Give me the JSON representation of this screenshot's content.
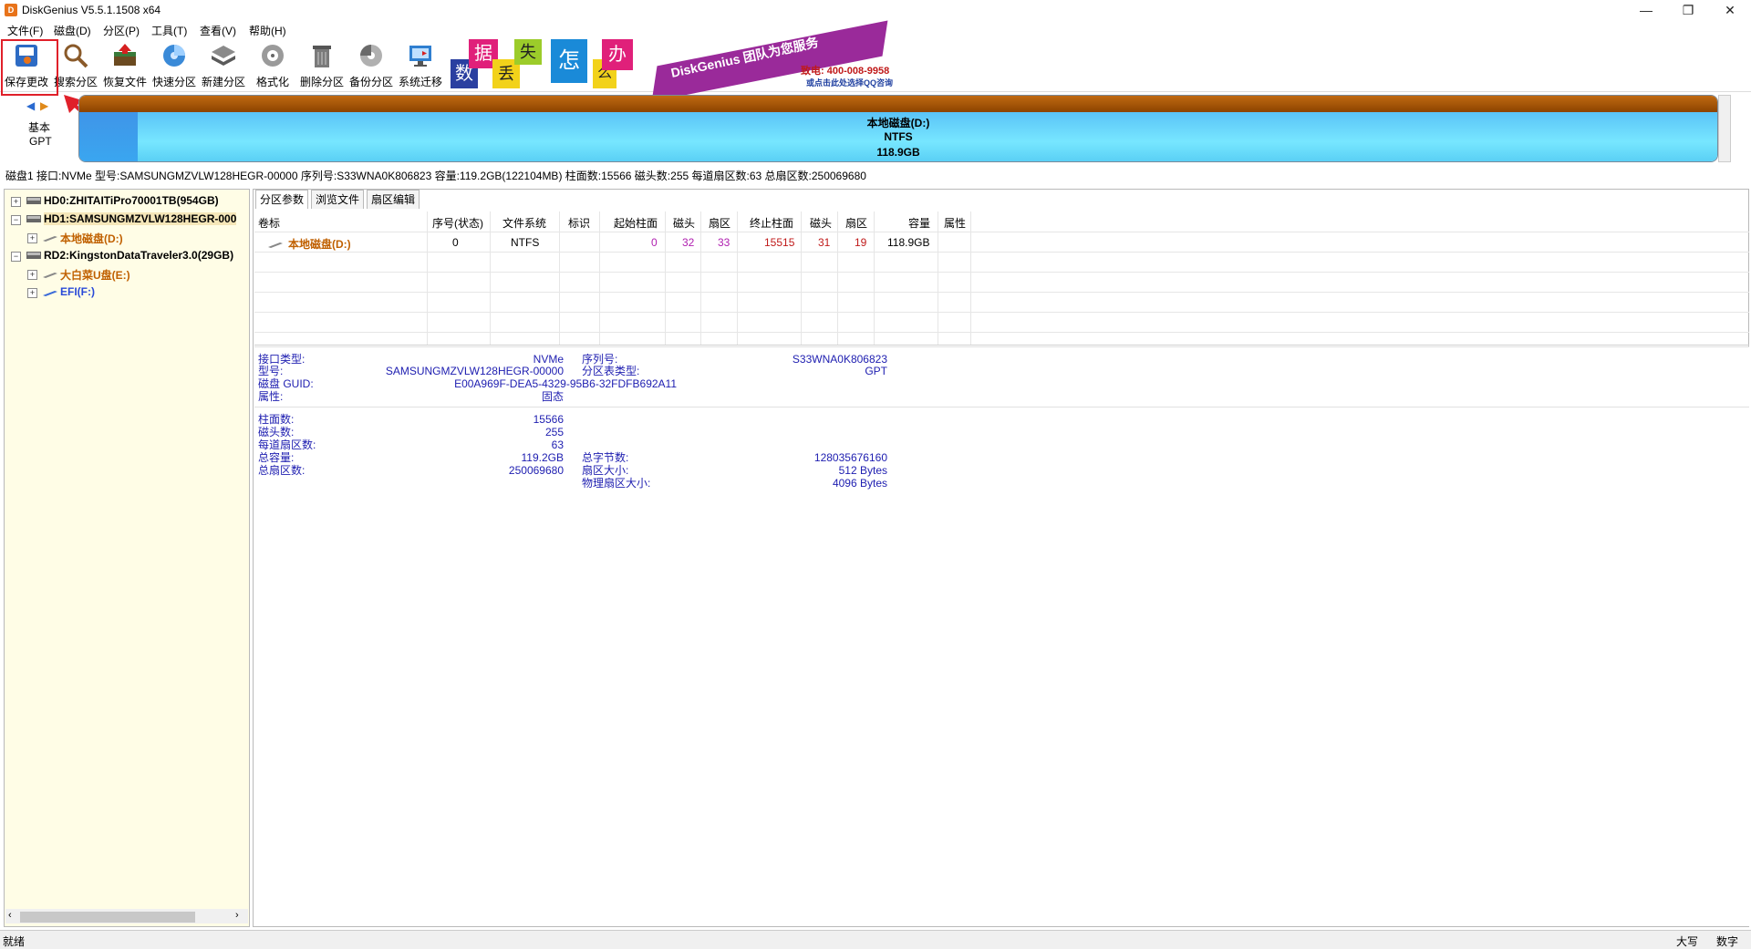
{
  "window": {
    "title": "DiskGenius V5.5.1.1508 x64",
    "icon_text": "D",
    "buttons": [
      "—",
      "❐",
      "✕"
    ]
  },
  "menu": [
    {
      "label": "文件(F)"
    },
    {
      "label": "磁盘(D)"
    },
    {
      "label": "分区(P)"
    },
    {
      "label": "工具(T)"
    },
    {
      "label": "查看(V)"
    },
    {
      "label": "帮助(H)"
    }
  ],
  "toolbar": [
    {
      "label": "保存更改",
      "icon": "save-icon"
    },
    {
      "label": "搜索分区",
      "icon": "search-icon"
    },
    {
      "label": "恢复文件",
      "icon": "recover-icon"
    },
    {
      "label": "快速分区",
      "icon": "quick-partition-icon"
    },
    {
      "label": "新建分区",
      "icon": "new-partition-icon"
    },
    {
      "label": "格式化",
      "icon": "format-icon"
    },
    {
      "label": "删除分区",
      "icon": "delete-icon"
    },
    {
      "label": "备份分区",
      "icon": "backup-icon"
    },
    {
      "label": "系统迁移",
      "icon": "migrate-icon"
    }
  ],
  "ad": {
    "chars": [
      "数",
      "据",
      "丢",
      "失",
      "怎",
      "么",
      "办"
    ],
    "slogan": "DiskGenius 团队为您服务",
    "phone": "致电: 400-008-9958",
    "qq": "或点击此处选择QQ咨询"
  },
  "disk_nav": {
    "line1": "基本",
    "line2": "GPT"
  },
  "disk_bar": {
    "name": "本地磁盘(D:)",
    "fs": "NTFS",
    "size": "118.9GB"
  },
  "disk_info": "磁盘1 接口:NVMe  型号:SAMSUNGMZVLW128HEGR-00000  序列号:S33WNA0K806823  容量:119.2GB(122104MB)  柱面数:15566  磁头数:255  每道扇区数:63  总扇区数:250069680",
  "tree": [
    {
      "label": "HD0:ZHITAITiPro70001TB(954GB)",
      "pm": "+"
    },
    {
      "label": "HD1:SAMSUNGMZVLW128HEGR-000",
      "pm": "−"
    },
    {
      "label": "本地磁盘(D:)",
      "pm": "+"
    },
    {
      "label": "RD2:KingstonDataTraveler3.0(29GB)",
      "pm": "−"
    },
    {
      "label": "大白菜U盘(E:)",
      "pm": "+"
    },
    {
      "label": "EFI(F:)",
      "pm": "+"
    }
  ],
  "tabs": [
    {
      "label": "分区参数"
    },
    {
      "label": "浏览文件"
    },
    {
      "label": "扇区编辑"
    }
  ],
  "table": {
    "headers": [
      "卷标",
      "序号(状态)",
      "文件系统",
      "标识",
      "起始柱面",
      "磁头",
      "扇区",
      "终止柱面",
      "磁头",
      "扇区",
      "容量",
      "属性"
    ],
    "row": [
      "本地磁盘(D:)",
      "0",
      "NTFS",
      "",
      "0",
      "32",
      "33",
      "15515",
      "31",
      "19",
      "118.9GB",
      ""
    ]
  },
  "info": {
    "iface_l": "接口类型:",
    "iface_v": "NVMe",
    "model_l": "型号:",
    "model_v": "SAMSUNGMZVLW128HEGR-00000",
    "guid_l": "磁盘 GUID:",
    "guid_v": "E00A969F-DEA5-4329-95B6-32FDFB692A11",
    "attr_l": "属性:",
    "attr_v": "固态",
    "serial_l": "序列号:",
    "serial_v": "S33WNA0K806823",
    "ptype_l": "分区表类型:",
    "ptype_v": "GPT",
    "cyl_l": "柱面数:",
    "cyl_v": "15566",
    "heads_l": "磁头数:",
    "heads_v": "255",
    "spt_l": "每道扇区数:",
    "spt_v": "63",
    "cap_l": "总容量:",
    "cap_v": "119.2GB",
    "sect_l": "总扇区数:",
    "sect_v": "250069680",
    "bytes_l": "总字节数:",
    "bytes_v": "128035676160",
    "ss_l": "扇区大小:",
    "ss_v": "512 Bytes",
    "pss_l": "物理扇区大小:",
    "pss_v": "4096 Bytes"
  },
  "status": {
    "left": "就绪",
    "caps": "大写",
    "num": "数字"
  }
}
